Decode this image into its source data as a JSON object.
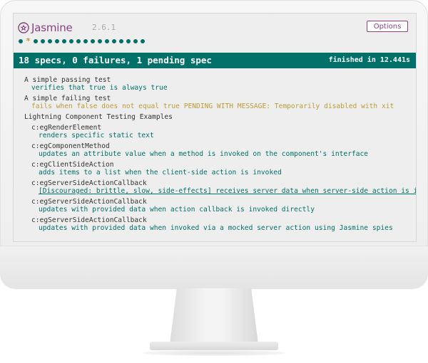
{
  "app": {
    "name": "Jasmine",
    "version": "2.6.1",
    "options_label": "Options",
    "brand_color": "#8a4182",
    "pass_color": "#007069",
    "pending_color": "#ba9d37"
  },
  "symbol_summary": [
    "passed",
    "pending",
    "passed",
    "passed",
    "passed",
    "passed",
    "passed",
    "passed",
    "passed",
    "passed",
    "passed",
    "passed",
    "passed",
    "passed",
    "passed",
    "passed",
    "passed",
    "passed"
  ],
  "bar": {
    "overall": "18 specs, 0 failures, 1 pending spec",
    "duration": "finished in 12.441s"
  },
  "results": {
    "suites": [
      {
        "name": "A simple passing test",
        "specs": [
          {
            "text": "verifies that true is always true",
            "status": "passed"
          }
        ]
      },
      {
        "name": "A simple failing test",
        "specs": [
          {
            "text": "fails when false does not equal true PENDING WITH MESSAGE: Temporarily disabled with xit",
            "status": "pending"
          }
        ]
      },
      {
        "name": "Lightning Component Testing Examples",
        "children": [
          {
            "name": "c:egRenderElement",
            "specs": [
              {
                "text": "renders specific static text",
                "status": "passed"
              }
            ]
          },
          {
            "name": "c:egComponentMethod",
            "specs": [
              {
                "text": "updates an attribute value when a method is invoked on the component's interface",
                "status": "passed"
              }
            ]
          },
          {
            "name": "c:egClientSideAction",
            "specs": [
              {
                "text": "adds items to a list when the client-side action is invoked",
                "status": "passed"
              }
            ]
          },
          {
            "name": "c:egServerSideActionCallback",
            "specs": [
              {
                "text": "[Discouraged: brittle, slow, side-effects] receives server data when server-side action is invoked",
                "status": "passed"
              }
            ]
          },
          {
            "name": "c:egServerSideActionCallback",
            "specs": [
              {
                "text": "updates with provided data when action callback is invoked directly",
                "status": "passed"
              }
            ]
          },
          {
            "name": "c:egServerSideActionCallback",
            "specs": [
              {
                "text": "updates with provided data when invoked via a mocked server action using Jasmine spies",
                "status": "passed"
              }
            ]
          }
        ]
      }
    ]
  }
}
